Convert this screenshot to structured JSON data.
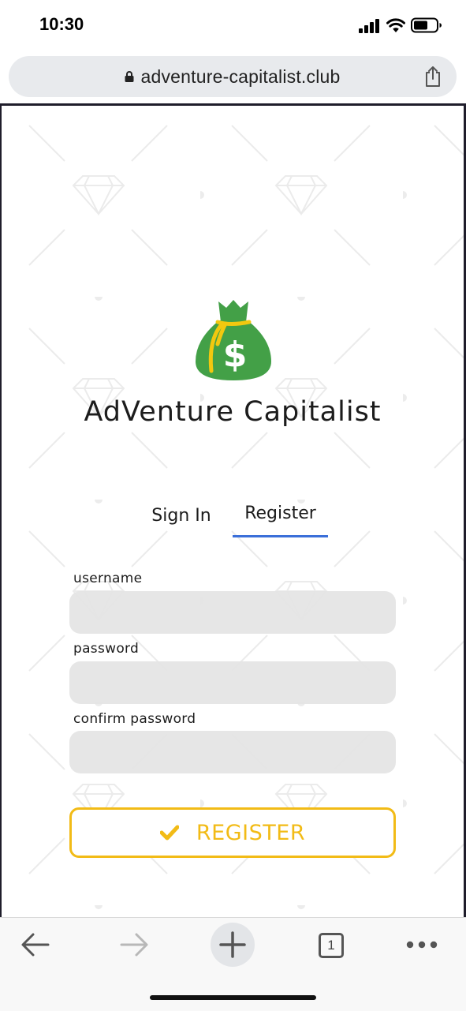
{
  "status_bar": {
    "time": "10:30"
  },
  "browser": {
    "url": "adventure-capitalist.club",
    "tab_count": "1"
  },
  "page": {
    "app_title": "AdVenture Capitalist",
    "tabs": [
      {
        "label": "Sign In",
        "active": false
      },
      {
        "label": "Register",
        "active": true
      }
    ],
    "form": {
      "fields": [
        {
          "label": "username",
          "value": ""
        },
        {
          "label": "password",
          "value": ""
        },
        {
          "label": "confirm password",
          "value": ""
        }
      ],
      "submit_label": "REGISTER"
    }
  },
  "icons": {
    "logo": "money-bag-icon",
    "submit": "check-icon",
    "lock": "lock-icon",
    "share": "share-icon",
    "back": "back-arrow-icon",
    "forward": "forward-arrow-icon",
    "new_tab": "plus-icon",
    "more": "more-dots-icon"
  },
  "colors": {
    "accent": "#f2bb16",
    "tab_underline": "#3b6fd9",
    "logo_bag": "#43a047",
    "logo_ribbon": "#f2c80f"
  }
}
